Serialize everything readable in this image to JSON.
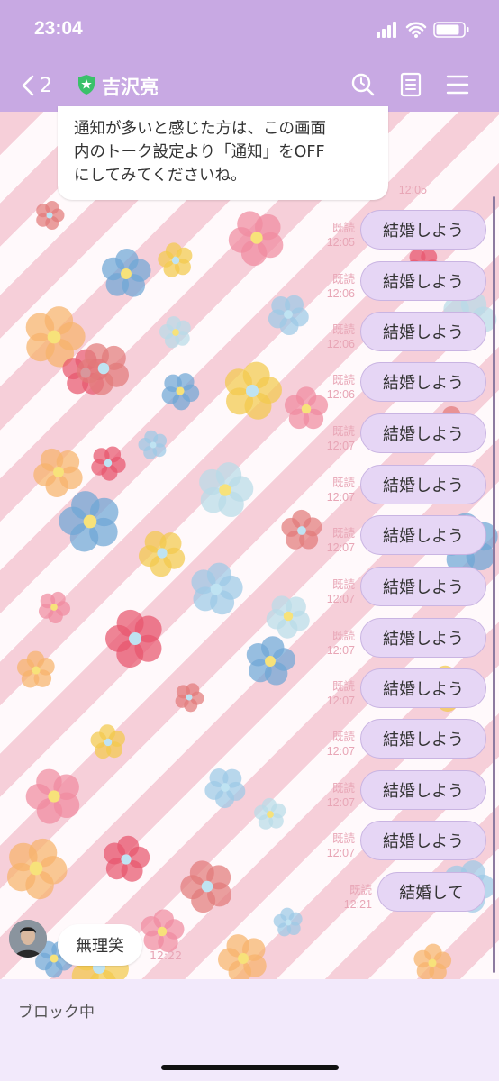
{
  "status_bar": {
    "time": "23:04"
  },
  "header": {
    "back_count": "2",
    "contact_name": "吉沢亮"
  },
  "notice": {
    "lines": [
      "通知が多いと感じた方は、この画面",
      "内のトーク設定より「通知」をOFF",
      "にしてみてくださいね。"
    ],
    "time": "12:05"
  },
  "messages": [
    {
      "text": "結婚しよう",
      "read": "既読",
      "time": "12:05"
    },
    {
      "text": "結婚しよう",
      "read": "既読",
      "time": "12:06"
    },
    {
      "text": "結婚しよう",
      "read": "既読",
      "time": "12:06"
    },
    {
      "text": "結婚しよう",
      "read": "既読",
      "time": "12:06"
    },
    {
      "text": "結婚しよう",
      "read": "既読",
      "time": "12:07"
    },
    {
      "text": "結婚しよう",
      "read": "既読",
      "time": "12:07"
    },
    {
      "text": "結婚しよう",
      "read": "既読",
      "time": "12:07"
    },
    {
      "text": "結婚しよう",
      "read": "既読",
      "time": "12:07"
    },
    {
      "text": "結婚しよう",
      "read": "既読",
      "time": "12:07"
    },
    {
      "text": "結婚しよう",
      "read": "既読",
      "time": "12:07"
    },
    {
      "text": "結婚しよう",
      "read": "既読",
      "time": "12:07"
    },
    {
      "text": "結婚しよう",
      "read": "既読",
      "time": "12:07"
    },
    {
      "text": "結婚しよう",
      "read": "既読",
      "time": "12:07"
    },
    {
      "text": "結婚して",
      "read": "既読",
      "time": "12:21"
    }
  ],
  "incoming": {
    "text": "無理笑",
    "time": "12:22"
  },
  "footer": {
    "status": "ブロック中"
  },
  "colors": {
    "header": "#c8a9e3",
    "bubble": "#e6d6f5",
    "footer": "#f2e9fb"
  }
}
